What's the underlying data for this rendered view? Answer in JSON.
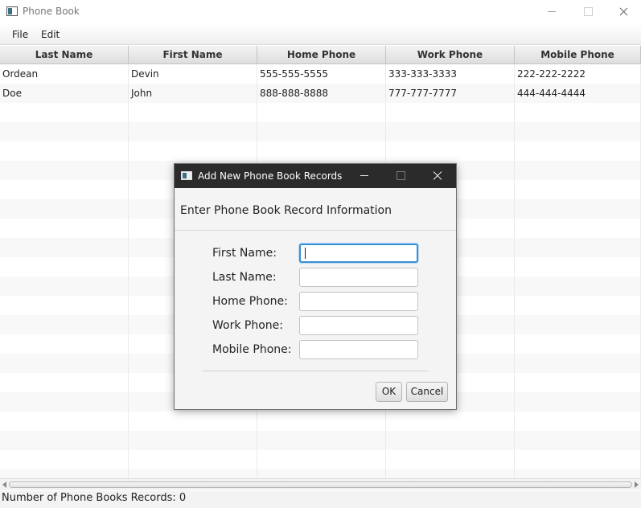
{
  "window": {
    "title": "Phone Book"
  },
  "menubar": {
    "items": [
      {
        "label": "File"
      },
      {
        "label": "Edit"
      }
    ]
  },
  "table": {
    "columns": [
      "Last Name",
      "First Name",
      "Home Phone",
      "Work Phone",
      "Mobile Phone"
    ],
    "rows": [
      [
        "Ordean",
        "Devin",
        "555-555-5555",
        "333-333-3333",
        "222-222-2222"
      ],
      [
        "Doe",
        "John",
        "888-888-8888",
        "777-777-7777",
        "444-444-4444"
      ]
    ]
  },
  "statusbar": {
    "text": "Number of Phone Books Records: 0"
  },
  "dialog": {
    "title": "Add New Phone Book Records",
    "header": "Enter Phone Book Record Information",
    "fields": [
      {
        "label": "First Name:",
        "value": ""
      },
      {
        "label": "Last Name:",
        "value": ""
      },
      {
        "label": "Home Phone:",
        "value": ""
      },
      {
        "label": "Work Phone:",
        "value": ""
      },
      {
        "label": "Mobile Phone:",
        "value": ""
      }
    ],
    "ok_label": "OK",
    "cancel_label": "Cancel"
  },
  "icons": {
    "app": "app-window-icon",
    "minimize": "minimize-icon",
    "maximize": "maximize-icon",
    "close": "close-icon"
  }
}
